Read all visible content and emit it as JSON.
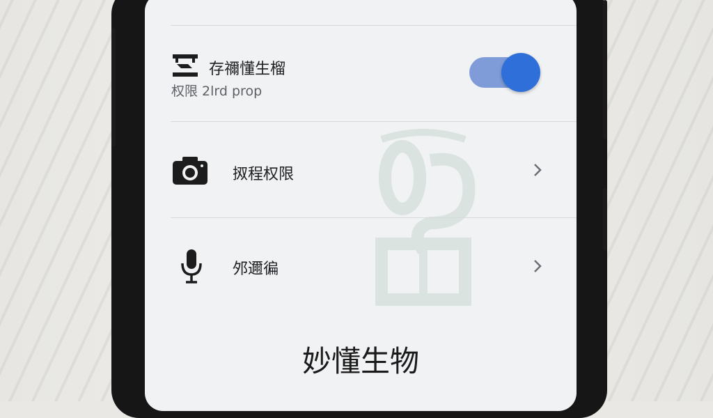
{
  "settings": {
    "storage": {
      "title": "存禰懂生榴",
      "subtitle": "权限 2lrd prop",
      "icon": "storage-icon",
      "toggle_on": true
    },
    "camera": {
      "title": "㧐程权限",
      "icon": "camera-icon",
      "chevron": "chevron-right-icon"
    },
    "microphone": {
      "title": "邜邇徧",
      "icon": "microphone-icon",
      "chevron": "chevron-right-icon"
    }
  },
  "footer": {
    "title": "妙懂生物"
  },
  "colors": {
    "toggle_track": "#7f9bd8",
    "toggle_thumb": "#2e6fd9",
    "screen_bg": "#f1f2f4"
  }
}
